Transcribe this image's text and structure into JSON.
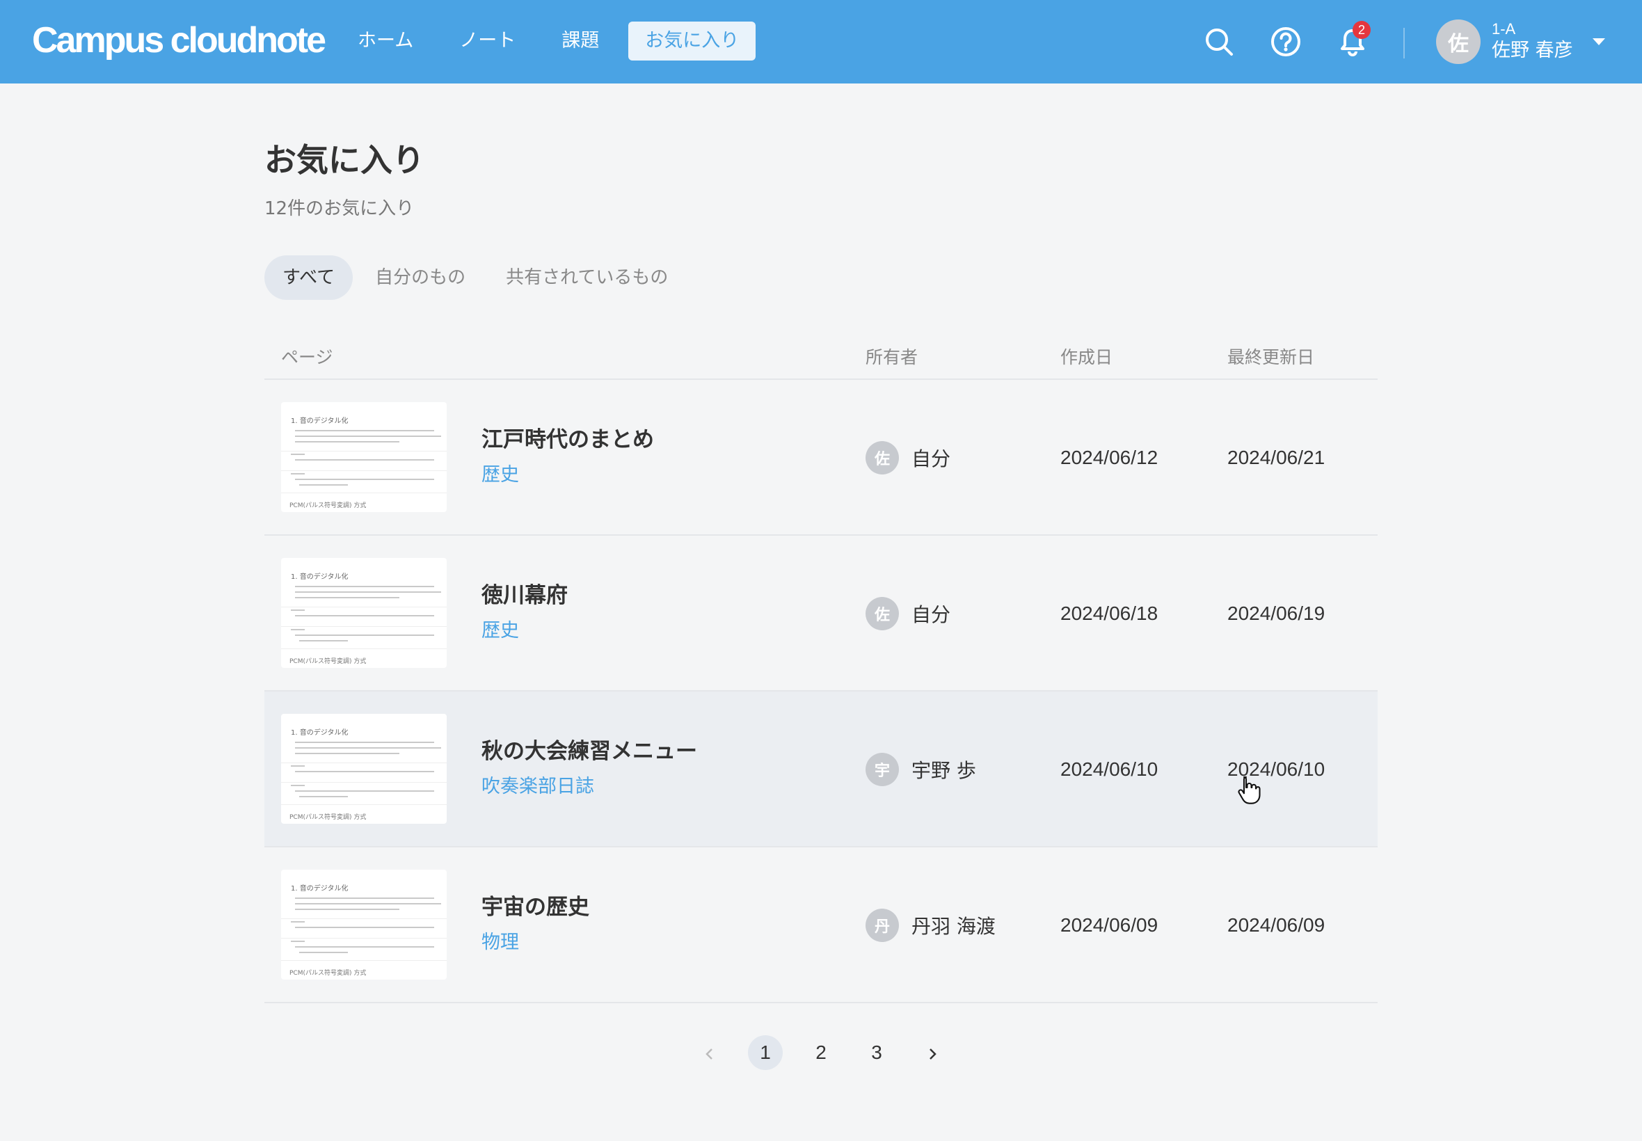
{
  "header": {
    "logo": "Campus cloudnote",
    "nav": [
      {
        "label": "ホーム"
      },
      {
        "label": "ノート"
      },
      {
        "label": "課題"
      },
      {
        "label": "お気に入り",
        "active": true
      }
    ],
    "icons": [
      "search-icon",
      "help-icon",
      "bell-icon"
    ],
    "notifications": "2",
    "user": {
      "avatar": "佐",
      "class": "1-A",
      "name": "佐野 春彦"
    }
  },
  "main": {
    "title": "お気に入り",
    "count": "12件のお気に入り",
    "filters": [
      {
        "label": "すべて",
        "active": true
      },
      {
        "label": "自分のもの"
      },
      {
        "label": "共有されているもの"
      }
    ],
    "columns": {
      "page": "ページ",
      "owner": "所有者",
      "created": "作成日",
      "updated": "最終更新日"
    },
    "rows": [
      {
        "title": "江戸時代のまとめ",
        "tag": "歴史",
        "owner_avatar": "佐",
        "owner": "自分",
        "created": "2024/06/12",
        "updated": "2024/06/21"
      },
      {
        "title": "徳川幕府",
        "tag": "歴史",
        "owner_avatar": "佐",
        "owner": "自分",
        "created": "2024/06/18",
        "updated": "2024/06/19"
      },
      {
        "title": "秋の大会練習メニュー",
        "tag": "吹奏楽部日誌",
        "owner_avatar": "宇",
        "owner": "宇野 歩",
        "created": "2024/06/10",
        "updated": "2024/06/10"
      },
      {
        "title": "宇宙の歴史",
        "tag": "物理",
        "owner_avatar": "丹",
        "owner": "丹羽 海渡",
        "created": "2024/06/09",
        "updated": "2024/06/09"
      }
    ],
    "thumbnail": {
      "title": "1. 音のデジタル化",
      "footer": "PCM(パルス符号変調) 方式"
    }
  },
  "pagination": {
    "pages": [
      "1",
      "2",
      "3"
    ],
    "current": "1"
  },
  "colors": {
    "brand": "#4aa3e4",
    "badge": "#e5363e",
    "background": "#f4f5f6"
  }
}
